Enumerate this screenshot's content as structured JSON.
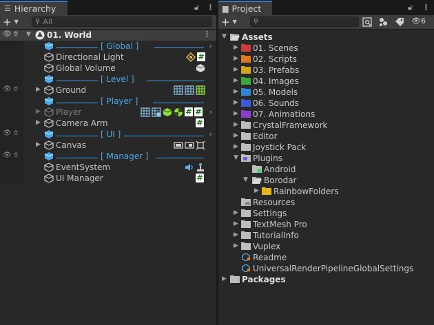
{
  "hierarchy": {
    "tab_title": "Hierarchy",
    "search_placeholder": "All",
    "scene_name": "01. World",
    "rows": [
      {
        "label": "[ Global ]",
        "type": "separator"
      },
      {
        "label": "Directional Light",
        "type": "object"
      },
      {
        "label": "Global Volume",
        "type": "object"
      },
      {
        "label": "[ Level ]",
        "type": "separator"
      },
      {
        "label": "Ground",
        "type": "object"
      },
      {
        "label": "[ Player ]",
        "type": "separator"
      },
      {
        "label": "Player",
        "type": "object-disabled"
      },
      {
        "label": "Camera Arm",
        "type": "object"
      },
      {
        "label": "[ UI ]",
        "type": "separator"
      },
      {
        "label": "Canvas",
        "type": "object"
      },
      {
        "label": "[ Manager ]",
        "type": "separator"
      },
      {
        "label": "EventSystem",
        "type": "object"
      },
      {
        "label": "UI Manager",
        "type": "object"
      }
    ]
  },
  "project": {
    "tab_title": "Project",
    "hidden_count": "6",
    "root_assets": "Assets",
    "root_packages": "Packages",
    "items": [
      {
        "label": "01. Scenes",
        "color": "#d23b3b"
      },
      {
        "label": "02. Scripts",
        "color": "#e07a22"
      },
      {
        "label": "03. Prefabs",
        "color": "#d6a41e"
      },
      {
        "label": "04. Images",
        "color": "#3aa83a"
      },
      {
        "label": "05. Models",
        "color": "#2f86d6"
      },
      {
        "label": "06. Sounds",
        "color": "#3d5bd6"
      },
      {
        "label": "07. Animations",
        "color": "#8a3fd0"
      },
      {
        "label": "CrystalFramework",
        "color": "#bdbdbd"
      },
      {
        "label": "Editor",
        "color": "#bdbdbd"
      },
      {
        "label": "Joystick Pack",
        "color": "#bdbdbd"
      },
      {
        "label": "Plugins",
        "color": "#bdbdbd"
      },
      {
        "label": "Android",
        "color": "#bdbdbd"
      },
      {
        "label": "Borodar",
        "color": "#bdbdbd"
      },
      {
        "label": "RainbowFolders",
        "color": "#e6b31e"
      },
      {
        "label": "Resources",
        "color": "#bdbdbd"
      },
      {
        "label": "Settings",
        "color": "#bdbdbd"
      },
      {
        "label": "TextMesh Pro",
        "color": "#bdbdbd"
      },
      {
        "label": "TutorialInfo",
        "color": "#bdbdbd"
      },
      {
        "label": "Vuplex",
        "color": "#bdbdbd"
      },
      {
        "label": "Readme",
        "color": "#bdbdbd"
      },
      {
        "label": "UniversalRenderPipelineGlobalSettings",
        "color": "#bdbdbd"
      }
    ]
  },
  "colors": {
    "accent": "#3a79bb",
    "separator": "#4aa6e6",
    "script_icon": "#1a7a1a"
  }
}
